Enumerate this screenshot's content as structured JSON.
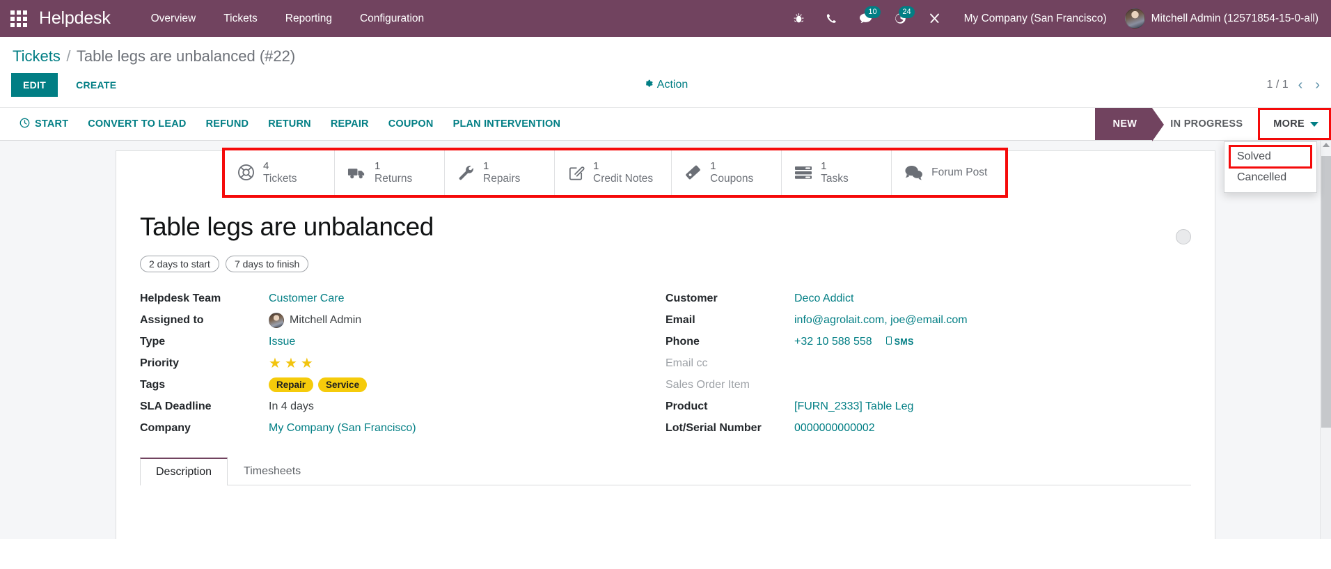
{
  "navbar": {
    "apps_icon": "apps-grid-icon",
    "brand": "Helpdesk",
    "menu": [
      {
        "label": "Overview"
      },
      {
        "label": "Tickets"
      },
      {
        "label": "Reporting"
      },
      {
        "label": "Configuration"
      }
    ],
    "sys_icons": [
      {
        "name": "bug-icon",
        "badge": ""
      },
      {
        "name": "phone-icon",
        "badge": ""
      },
      {
        "name": "messages-icon",
        "badge": "10"
      },
      {
        "name": "activities-clock-icon",
        "badge": "24"
      },
      {
        "name": "tools-icon",
        "badge": ""
      }
    ],
    "company": "My Company (San Francisco)",
    "user": "Mitchell Admin (12571854-15-0-all)",
    "brand_color": "#71435f",
    "badge_color": "#017e84"
  },
  "breadcrumb": {
    "root": "Tickets",
    "separator": "/",
    "current": "Table legs are unbalanced (#22)"
  },
  "toolbar": {
    "edit_label": "EDIT",
    "create_label": "CREATE",
    "action_label": "Action",
    "pager_text": "1 / 1",
    "prev_arrow": "‹",
    "next_arrow": "›"
  },
  "workflow_buttons": [
    {
      "label": "START",
      "icon": "clock-icon"
    },
    {
      "label": "CONVERT TO LEAD",
      "icon": ""
    },
    {
      "label": "REFUND",
      "icon": ""
    },
    {
      "label": "RETURN",
      "icon": ""
    },
    {
      "label": "REPAIR",
      "icon": ""
    },
    {
      "label": "COUPON",
      "icon": ""
    },
    {
      "label": "PLAN INTERVENTION",
      "icon": ""
    }
  ],
  "statusbar": {
    "stages": [
      {
        "label": "NEW",
        "active": true
      },
      {
        "label": "IN PROGRESS",
        "active": false
      }
    ],
    "more_label": "MORE",
    "more_open": true,
    "dropdown_items": [
      {
        "label": "Solved",
        "highlighted": true
      },
      {
        "label": "Cancelled",
        "highlighted": false
      }
    ],
    "highlight_color": "#f50a0a",
    "active_color": "#71435f"
  },
  "smart_buttons": [
    {
      "value": "4",
      "label": "Tickets",
      "icon": "lifebuoy-icon"
    },
    {
      "value": "1",
      "label": "Returns",
      "icon": "truck-icon"
    },
    {
      "value": "1",
      "label": "Repairs",
      "icon": "wrench-icon"
    },
    {
      "value": "1",
      "label": "Credit Notes",
      "icon": "edit-document-icon"
    },
    {
      "value": "1",
      "label": "Coupons",
      "icon": "ticket-tag-icon"
    },
    {
      "value": "1",
      "label": "Tasks",
      "icon": "tasks-list-icon"
    },
    {
      "value": "",
      "label": "Forum Post",
      "icon": "comments-icon"
    }
  ],
  "record": {
    "title": "Table legs are unbalanced",
    "sla_pills": [
      {
        "label": "2 days to start"
      },
      {
        "label": "7 days to finish"
      }
    ],
    "kanban_state": "grey"
  },
  "fields_left": [
    {
      "label": "Helpdesk Team",
      "value": "Customer Care",
      "type": "link"
    },
    {
      "label": "Assigned to",
      "value": "Mitchell Admin",
      "type": "avatar"
    },
    {
      "label": "Type",
      "value": "Issue",
      "type": "link"
    },
    {
      "label": "Priority",
      "value": "3",
      "type": "stars",
      "stars": 3
    },
    {
      "label": "Tags",
      "value": "",
      "type": "tags",
      "tags": [
        "Repair",
        "Service"
      ]
    },
    {
      "label": "SLA Deadline",
      "value": "In 4 days",
      "type": "text"
    },
    {
      "label": "Company",
      "value": "My Company (San Francisco)",
      "type": "link"
    }
  ],
  "fields_right": [
    {
      "label": "Customer",
      "value": "Deco Addict",
      "type": "link"
    },
    {
      "label": "Email",
      "value": "info@agrolait.com, joe@email.com",
      "type": "link"
    },
    {
      "label": "Phone",
      "value": "+32 10 588 558",
      "type": "phone",
      "sms_label": "SMS"
    },
    {
      "label": "Email cc",
      "value": "",
      "type": "empty"
    },
    {
      "label": "Sales Order Item",
      "value": "",
      "type": "empty"
    },
    {
      "label": "Product",
      "value": "[FURN_2333] Table Leg",
      "type": "link"
    },
    {
      "label": "Lot/Serial Number",
      "value": "0000000000002",
      "type": "link"
    }
  ],
  "notebook": {
    "tabs": [
      {
        "label": "Description",
        "active": true
      },
      {
        "label": "Timesheets",
        "active": false
      }
    ]
  }
}
